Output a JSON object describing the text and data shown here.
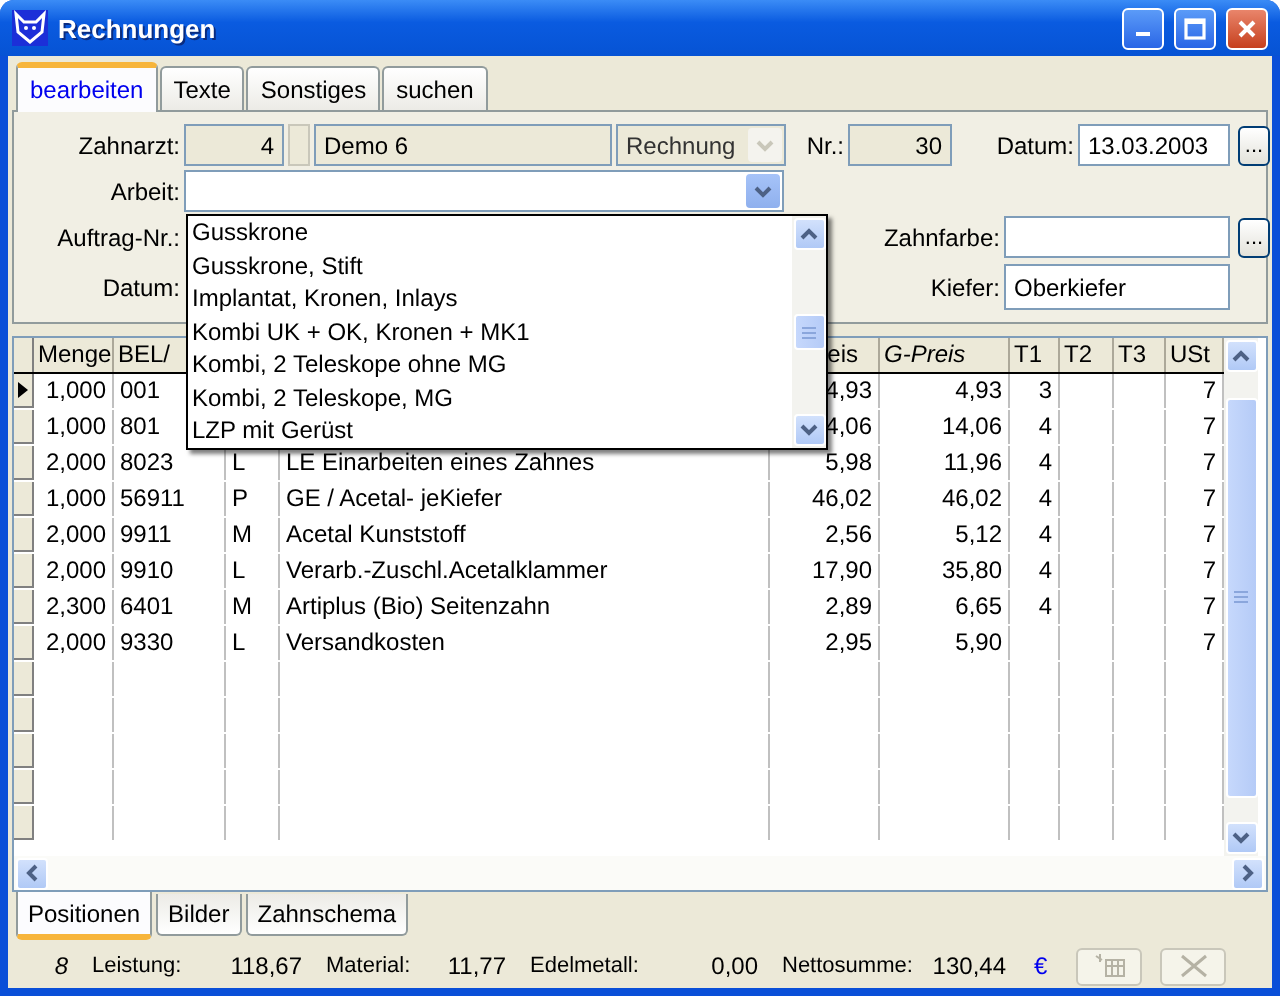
{
  "window": {
    "title": "Rechnungen"
  },
  "tabs": [
    {
      "label": "bearbeiten",
      "selected": true
    },
    {
      "label": "Texte",
      "selected": false
    },
    {
      "label": "Sonstiges",
      "selected": false
    },
    {
      "label": "suchen",
      "selected": false
    }
  ],
  "form": {
    "zahnarzt": {
      "label": "Zahnarzt:",
      "number": "4",
      "name": "Demo 6"
    },
    "belegart": {
      "value": "Rechnung",
      "disabled": true
    },
    "nr": {
      "label": "Nr.:",
      "value": "30"
    },
    "datum": {
      "label": "Datum:",
      "value": "13.03.2003",
      "button": "..."
    },
    "arbeit": {
      "label": "Arbeit:",
      "expanded": true,
      "options": [
        "Gusskrone",
        "Gusskrone, Stift",
        "Implantat, Kronen, Inlays",
        "Kombi UK + OK, Kronen + MK1",
        "Kombi, 2 Teleskope ohne MG",
        "Kombi, 2 Teleskope, MG",
        "LZP mit Gerüst"
      ]
    },
    "auftrag_nr": {
      "label": "Auftrag-Nr.:"
    },
    "zahnfarbe": {
      "label": "Zahnfarbe:",
      "button": "..."
    },
    "datum_2": {
      "label": "Datum:"
    },
    "kiefer": {
      "label": "Kiefer:",
      "value": "Oberkiefer"
    }
  },
  "table": {
    "header": {
      "menge": "Menge",
      "bel": "BEL/",
      "preis": "eis",
      "g_preis": "G-Preis",
      "t1": "T1",
      "t2": "T2",
      "t3": "T3",
      "ust": "USt"
    },
    "rows": [
      {
        "selected": true,
        "menge": "1,000",
        "bel": "001",
        "preis": "4,93",
        "g_preis": "4,93",
        "t1": "3",
        "ust": "7"
      },
      {
        "selected": false,
        "menge": "1,000",
        "bel": "801",
        "preis": "4,06",
        "g_preis": "14,06",
        "t1": "4",
        "ust": "7"
      },
      {
        "selected": false,
        "menge": "2,000",
        "bel": "8023",
        "column_3": "L",
        "column_4": "LE Einarbeiten eines Zahnes",
        "preis": "5,98",
        "g_preis": "11,96",
        "t1": "4",
        "ust": "7"
      },
      {
        "selected": false,
        "menge": "1,000",
        "bel": "56911",
        "column_3": "P",
        "column_4": "GE / Acetal- jeKiefer",
        "preis": "46,02",
        "g_preis": "46,02",
        "t1": "4",
        "ust": "7"
      },
      {
        "selected": false,
        "menge": "2,000",
        "bel": "9911",
        "column_3": "M",
        "column_4": "Acetal Kunststoff",
        "preis": "2,56",
        "g_preis": "5,12",
        "t1": "4",
        "ust": "7"
      },
      {
        "selected": false,
        "menge": "2,000",
        "bel": "9910",
        "column_3": "L",
        "column_4": "Verarb.-Zuschl.Acetalklammer",
        "preis": "17,90",
        "g_preis": "35,80",
        "t1": "4",
        "ust": "7"
      },
      {
        "selected": false,
        "menge": "2,300",
        "bel": "6401",
        "column_3": "M",
        "column_4": "Artiplus (Bio) Seitenzahn",
        "preis": "2,89",
        "g_preis": "6,65",
        "t1": "4",
        "ust": "7"
      },
      {
        "selected": false,
        "menge": "2,000",
        "bel": "9330",
        "column_3": "L",
        "column_4": "Versandkosten",
        "preis": "2,95",
        "g_preis": "5,90",
        "ust": "7"
      }
    ]
  },
  "bottom_tabs": [
    {
      "label": "Positionen",
      "selected": true
    },
    {
      "label": "Bilder",
      "selected": false
    },
    {
      "label": "Zahnschema",
      "selected": false
    }
  ],
  "status_bar": {
    "count": "8",
    "leistung": {
      "label": "Leistung:",
      "value": "118,67"
    },
    "material": {
      "label": "Material:",
      "value": "11,77"
    },
    "edelmetall": {
      "label": "Edelmetall:",
      "value": "0,00"
    },
    "nettosumme": {
      "label": "Nettosumme:",
      "value": "130,44"
    },
    "currency": "€",
    "buttons_disabled": true
  }
}
